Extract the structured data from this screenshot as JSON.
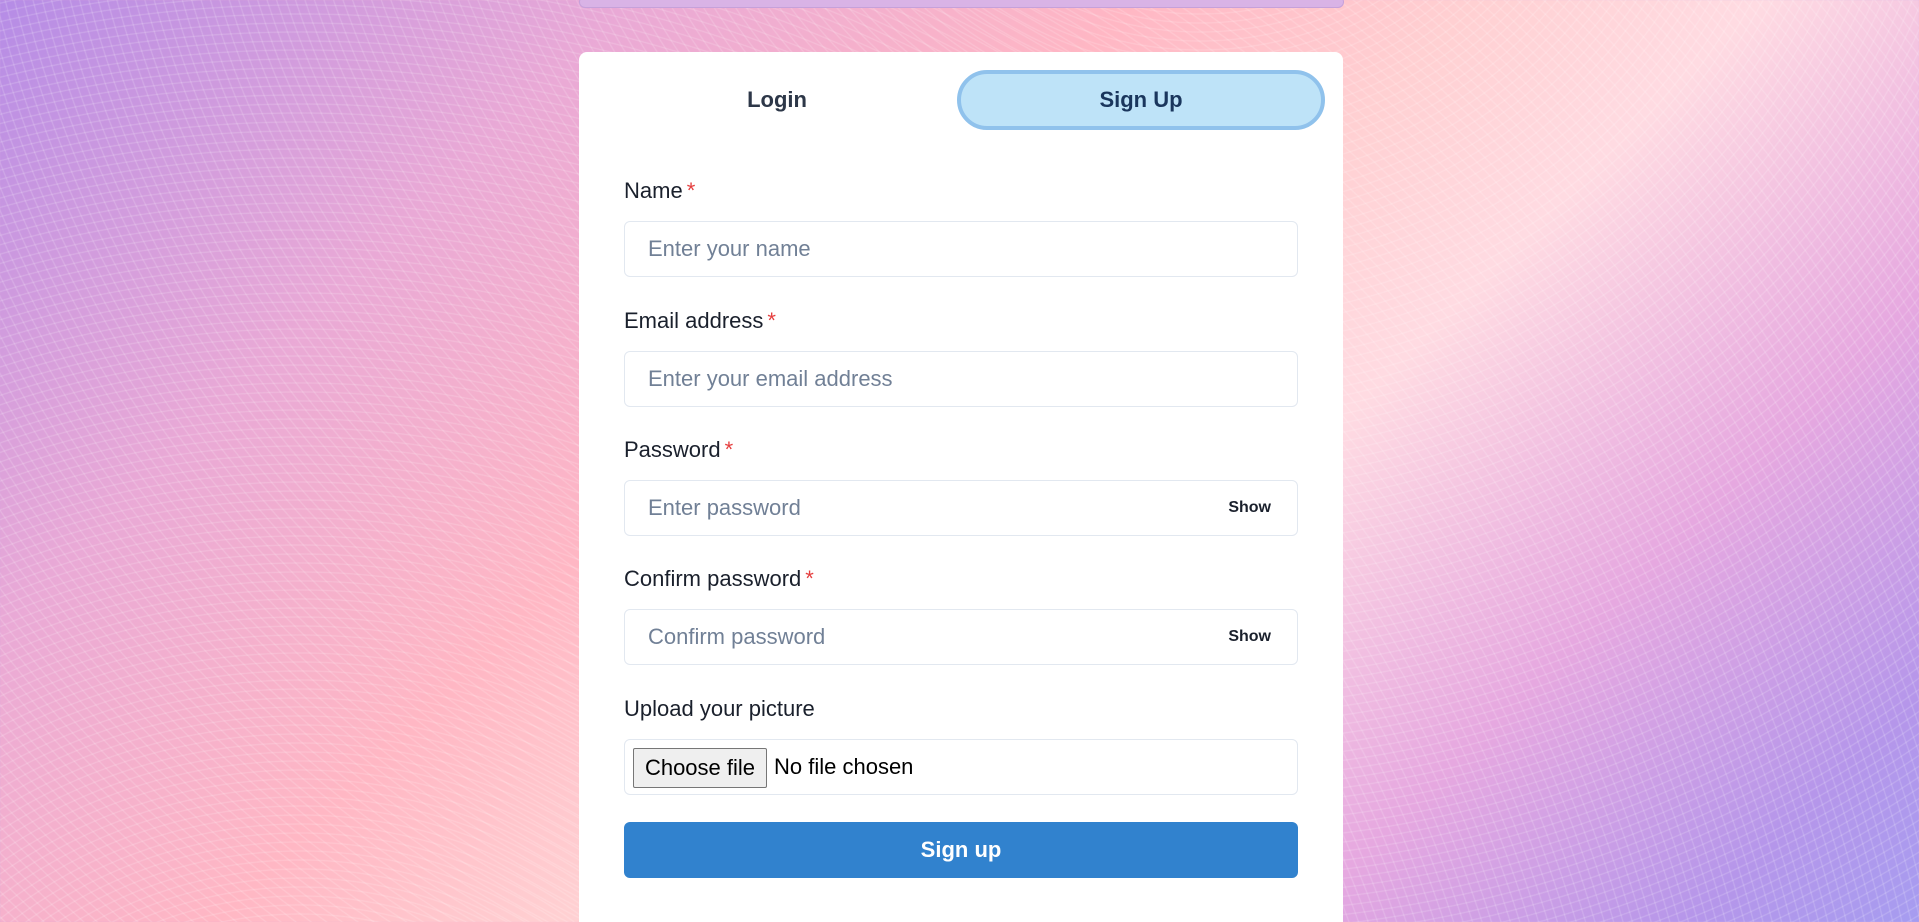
{
  "tabs": [
    {
      "label": "Login",
      "active": false
    },
    {
      "label": "Sign Up",
      "active": true
    }
  ],
  "form": {
    "name": {
      "label": "Name",
      "required_mark": "*",
      "placeholder": "Enter your name",
      "value": ""
    },
    "email": {
      "label": "Email address",
      "required_mark": "*",
      "placeholder": "Enter your email address",
      "value": ""
    },
    "password": {
      "label": "Password",
      "required_mark": "*",
      "placeholder": "Enter password",
      "value": "",
      "toggle_label": "Show"
    },
    "confirm": {
      "label": "Confirm password",
      "required_mark": "*",
      "placeholder": "Confirm password",
      "value": "",
      "toggle_label": "Show"
    },
    "picture": {
      "label": "Upload your picture",
      "button_label": "Choose file",
      "status": "No file chosen"
    },
    "submit_label": "Sign up"
  },
  "colors": {
    "primary": "#3182ce",
    "active_tab_bg": "#bee3f8",
    "active_tab_border": "#90c2ec",
    "required": "#e53e3e"
  }
}
